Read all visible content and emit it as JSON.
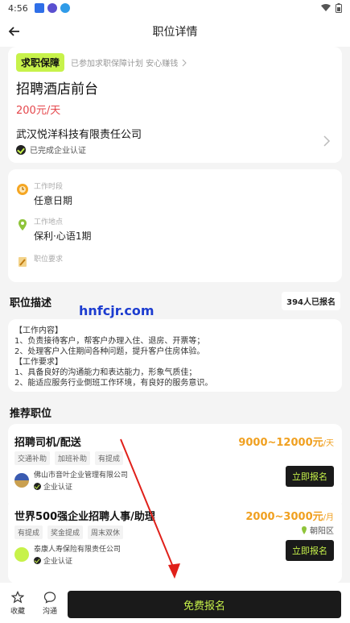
{
  "status": {
    "time": "4:56"
  },
  "nav": {
    "title": "职位详情"
  },
  "header": {
    "badge": "求职保障",
    "badge_note": "已参加求职保障计划 安心赚钱",
    "job_title": "招聘酒店前台",
    "salary": "200元/天",
    "company": "武汉悦洋科技有限责任公司",
    "verified": "已完成企业认证"
  },
  "info": {
    "time_label": "工作时段",
    "time_value": "任意日期",
    "place_label": "工作地点",
    "place_value": "保利·心语1期",
    "req_label": "职位要求"
  },
  "description": {
    "title": "职位描述",
    "apply_count": "394人已报名",
    "text": "【工作内容】\n1、负责接待客户，帮客户办理入住、退房、开票等；\n2、处理客户入住期间各种问题，提升客户住房体验。\n【工作要求】\n1、具备良好的沟通能力和表达能力，形象气质佳；\n2、能适应服务行业倒班工作环境，有良好的服务意识。"
  },
  "recommend": {
    "title": "推荐职位",
    "items": [
      {
        "title": "招聘司机/配送",
        "salary": "9000~12000元",
        "unit": "/天",
        "tags": [
          "交通补助",
          "加班补助",
          "有提成"
        ],
        "company": "佛山市音叶企业管理有限公司",
        "verified": "企业认证",
        "apply": "立即报名",
        "district": ""
      },
      {
        "title": "世界500强企业招聘人事/助理",
        "salary": "2000~3000元",
        "unit": "/月",
        "tags": [
          "有提成",
          "奖金提成",
          "周末双休"
        ],
        "company": "泰康人寿保险有限责任公司",
        "verified": "企业认证",
        "apply": "立即报名",
        "district": "朝阳区"
      }
    ]
  },
  "bottom": {
    "collect": "收藏",
    "chat": "沟通",
    "free_apply": "免费报名"
  },
  "watermark": "hnfcjr.com",
  "colors": {
    "accent": "#c7f24a",
    "salary_red": "#e5464b",
    "salary_orange": "#f0a020",
    "dark": "#1a1a1a"
  }
}
